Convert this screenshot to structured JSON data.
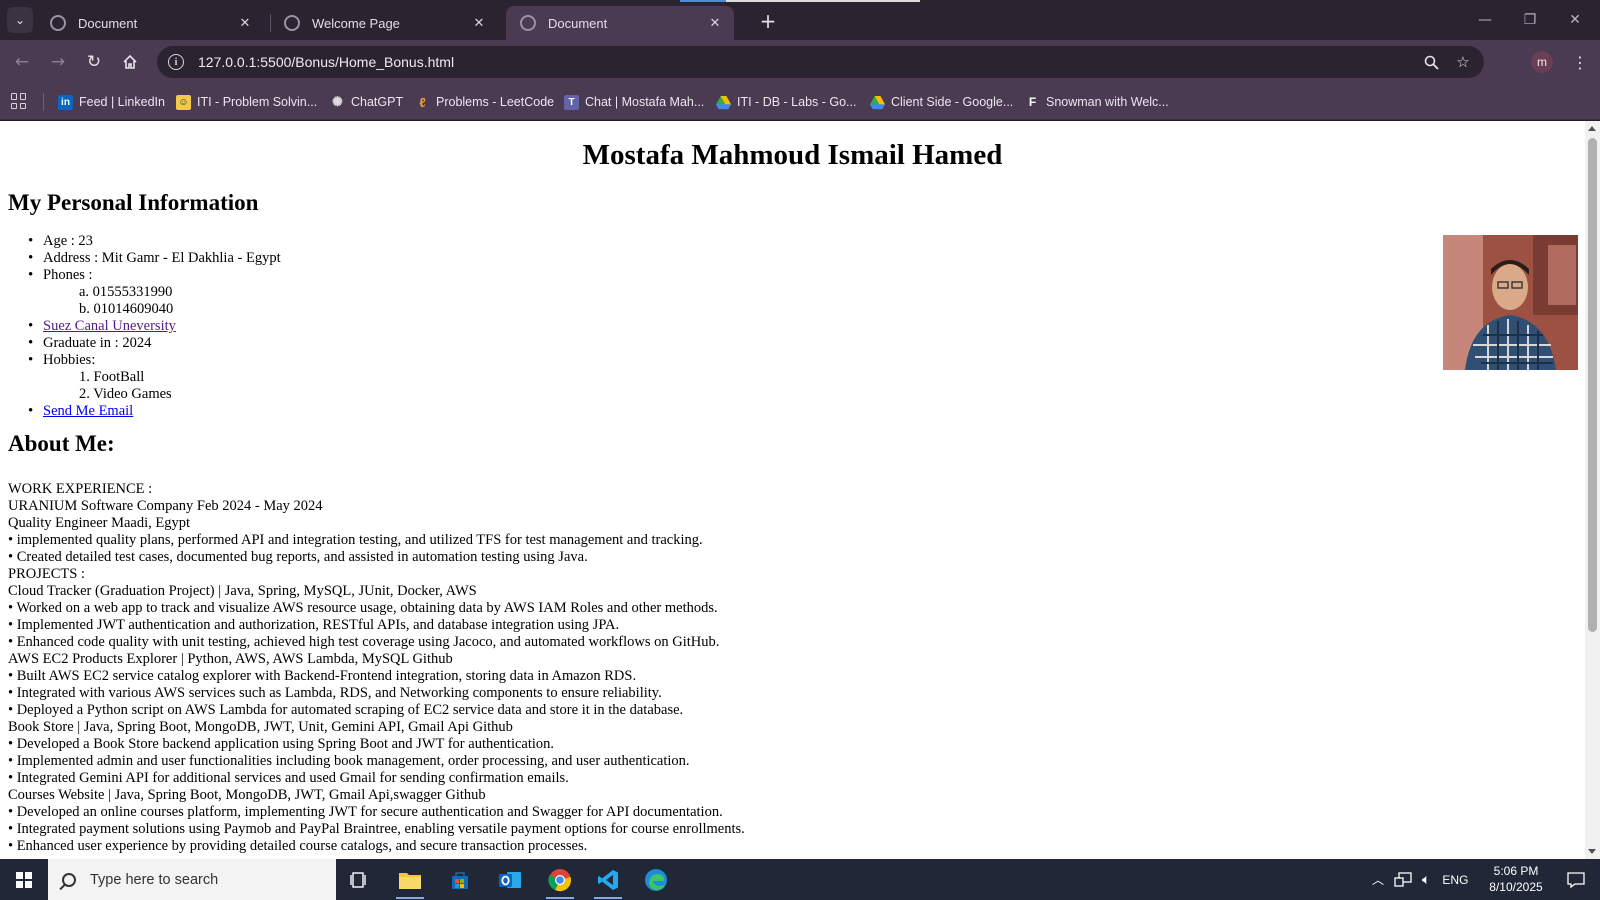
{
  "browser": {
    "tabs": [
      {
        "title": "Document",
        "active": false
      },
      {
        "title": "Welcome Page",
        "active": false
      },
      {
        "title": "Document",
        "active": true
      }
    ],
    "url": "127.0.0.1:5500/Bonus/Home_Bonus.html",
    "profile_initial": "m",
    "bookmarks": [
      {
        "label": "Feed | LinkedIn",
        "icon": "linkedin-icon"
      },
      {
        "label": "ITI - Problem Solvin...",
        "icon": "iti-icon"
      },
      {
        "label": "ChatGPT",
        "icon": "chatgpt-icon"
      },
      {
        "label": "Problems - LeetCode",
        "icon": "leetcode-icon"
      },
      {
        "label": "Chat | Mostafa Mah...",
        "icon": "teams-icon"
      },
      {
        "label": "ITI - DB - Labs - Go...",
        "icon": "google-drive-icon"
      },
      {
        "label": "Client Side - Google...",
        "icon": "google-drive-icon"
      },
      {
        "label": "Snowman with Welc...",
        "icon": "figma-icon"
      }
    ]
  },
  "page": {
    "title": "Mostafa Mahmoud Ismail Hamed",
    "personal_heading": "My Personal Information",
    "age": "Age : 23",
    "address": "Address : Mit Gamr - El Dakhlia - Egypt",
    "phones_label": "Phones :",
    "phones": [
      "a. 01555331990",
      "b. 01014609040"
    ],
    "university_link": "Suez Canal Uneversity",
    "graduate": "Graduate in : 2024",
    "hobbies_label": "Hobbies:",
    "hobbies": [
      "1. FootBall",
      "2. Video Games"
    ],
    "email_link": "Send Me Email",
    "about_heading": "About Me:",
    "about_lines": [
      "WORK EXPERIENCE :",
      "URANIUM Software Company Feb 2024 - May 2024",
      "Quality Engineer Maadi, Egypt",
      "• implemented quality plans, performed API and integration testing, and utilized TFS for test management and tracking.",
      "• Created detailed test cases, documented bug reports, and assisted in automation testing using Java.",
      "PROJECTS :",
      "Cloud Tracker (Graduation Project) | Java, Spring, MySQL, JUnit, Docker, AWS",
      "• Worked on a web app to track and visualize AWS resource usage, obtaining data by AWS IAM Roles and other methods.",
      "• Implemented JWT authentication and authorization, RESTful APIs, and database integration using JPA.",
      "• Enhanced code quality with unit testing, achieved high test coverage using Jacoco, and automated workflows on GitHub.",
      "AWS EC2 Products Explorer | Python, AWS, AWS Lambda, MySQL Github",
      "• Built AWS EC2 service catalog explorer with Backend-Frontend integration, storing data in Amazon RDS.",
      "• Integrated with various AWS services such as Lambda, RDS, and Networking components to ensure reliability.",
      "• Deployed a Python script on AWS Lambda for automated scraping of EC2 service data and store it in the database.",
      "Book Store | Java, Spring Boot, MongoDB, JWT, Unit, Gemini API, Gmail Api Github",
      "• Developed a Book Store backend application using Spring Boot and JWT for authentication.",
      "• Implemented admin and user functionalities including book management, order processing, and user authentication.",
      "• Integrated Gemini API for additional services and used Gmail for sending confirmation emails.",
      "Courses Website | Java, Spring Boot, MongoDB, JWT, Gmail Api,swagger Github",
      "• Developed an online courses platform, implementing JWT for secure authentication and Swagger for API documentation.",
      "• Integrated payment solutions using Paymob and PayPal Braintree, enabling versatile payment options for course enrollments.",
      "• Enhanced user experience by providing detailed course catalogs, and secure transaction processes."
    ]
  },
  "taskbar": {
    "search_placeholder": "Type here to search",
    "apps": [
      "task-view-icon",
      "file-explorer-icon",
      "microsoft-store-icon",
      "outlook-icon",
      "chrome-icon",
      "vscode-icon",
      "edge-icon"
    ],
    "language": "ENG",
    "time": "5:06 PM",
    "date": "8/10/2025"
  },
  "colors": {
    "tab_strip": "#2b2330",
    "toolbar": "#4a3a52",
    "visited_link": "#551a8b",
    "link": "#0000ee",
    "taskbar": "#202737"
  }
}
